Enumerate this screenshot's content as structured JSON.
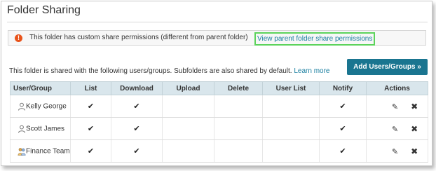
{
  "title": "Folder Sharing",
  "alert": {
    "icon": "exclamation-icon",
    "text": "This folder has custom share permissions (different from parent folder)",
    "link": "View parent folder share permissions"
  },
  "intro": {
    "text": "This folder is shared with the following users/groups. Subfolders are also shared by default.",
    "learn_more": "Learn more"
  },
  "add_button": "Add Users/Groups »",
  "columns": [
    "User/Group",
    "List",
    "Download",
    "Upload",
    "Delete",
    "User List",
    "Notify",
    "Actions"
  ],
  "rows": [
    {
      "name": "Kelly George",
      "type": "user",
      "list": true,
      "download": true,
      "upload": false,
      "delete": false,
      "user_list": false,
      "notify": true
    },
    {
      "name": "Scott James",
      "type": "user",
      "list": true,
      "download": true,
      "upload": false,
      "delete": false,
      "user_list": false,
      "notify": true
    },
    {
      "name": "Finance Team",
      "type": "group",
      "list": true,
      "download": true,
      "upload": false,
      "delete": false,
      "user_list": false,
      "notify": true
    }
  ],
  "icons": {
    "check": "✔",
    "edit": "✎",
    "delete": "✖"
  },
  "colors": {
    "accent": "#1a7590",
    "link": "#1a7fa0",
    "alert_icon": "#e8531a",
    "header_bg": "#d9e6ec",
    "highlight": "#5cd35c"
  }
}
